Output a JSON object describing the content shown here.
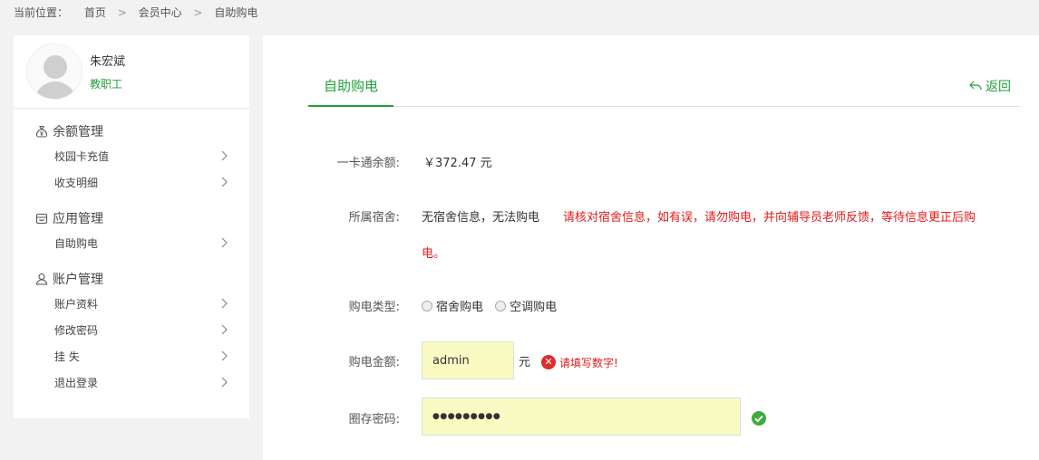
{
  "breadcrumb": {
    "label": "当前位置：",
    "items": [
      "首页",
      "会员中心",
      "自助购电"
    ],
    "separator": ">"
  },
  "user": {
    "name": "朱宏斌",
    "role": "教职工"
  },
  "sidebar": {
    "groups": [
      {
        "title": "余额管理",
        "icon": "money-bag-icon",
        "items": [
          "校园卡充值",
          "收支明细"
        ]
      },
      {
        "title": "应用管理",
        "icon": "box-icon",
        "items": [
          "自助购电"
        ]
      },
      {
        "title": "账户管理",
        "icon": "user-icon",
        "items": [
          "账户资料",
          "修改密码",
          "挂 失",
          "退出登录"
        ]
      }
    ]
  },
  "main": {
    "tab_label": "自助购电",
    "back_label": "返回",
    "balance_label": "一卡通余额:",
    "balance_value": "￥372.47 元",
    "dorm_label": "所属宿舍:",
    "dorm_value": "无宿舍信息，无法购电",
    "dorm_warning_line1": "请核对宿舍信息，如有误，请勿购电，并向辅导员老师反馈，等待信息更正后购",
    "dorm_warning_line2": "电。",
    "type_label": "购电类型:",
    "type_options": [
      "宿舍购电",
      "空调购电"
    ],
    "amount_label": "购电金额:",
    "amount_value": "admin",
    "amount_unit": "元",
    "amount_error": "请填写数字!",
    "password_label": "圈存密码:",
    "password_value": "●●●●●●●●●"
  },
  "colors": {
    "accent": "#21a03a",
    "error": "#e21b1b",
    "input_bg": "#fafbc3"
  }
}
